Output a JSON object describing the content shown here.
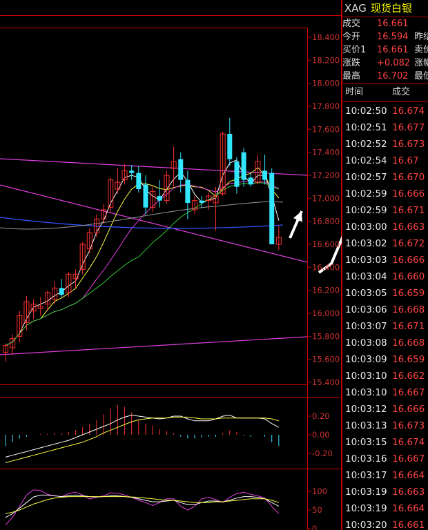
{
  "chart_data": {
    "type": "candlestick",
    "price_axis": {
      "ylim": [
        15.4,
        18.5
      ],
      "ticks": [
        "18.400",
        "18.200",
        "18.000",
        "17.800",
        "17.600",
        "17.400",
        "17.200",
        "17.000",
        "16.800",
        "16.600",
        "16.400",
        "16.200",
        "16.000",
        "15.800",
        "15.600",
        "15.400"
      ],
      "tick_values": [
        18.4,
        18.2,
        18.0,
        17.8,
        17.6,
        17.4,
        17.2,
        17.0,
        16.8,
        16.6,
        16.4,
        16.2,
        16.0,
        15.8,
        15.6,
        15.4
      ]
    },
    "candles": [
      {
        "o": 15.66,
        "h": 15.74,
        "l": 15.58,
        "c": 15.72
      },
      {
        "o": 15.7,
        "h": 15.82,
        "l": 15.64,
        "c": 15.78
      },
      {
        "o": 15.8,
        "h": 16.02,
        "l": 15.75,
        "c": 15.98
      },
      {
        "o": 15.92,
        "h": 16.15,
        "l": 15.85,
        "c": 16.1
      },
      {
        "o": 16.02,
        "h": 16.12,
        "l": 15.95,
        "c": 16.08
      },
      {
        "o": 16.04,
        "h": 16.14,
        "l": 15.98,
        "c": 16.06
      },
      {
        "o": 16.08,
        "h": 16.2,
        "l": 16.02,
        "c": 16.18
      },
      {
        "o": 16.12,
        "h": 16.28,
        "l": 16.08,
        "c": 16.22
      },
      {
        "o": 16.22,
        "h": 16.3,
        "l": 16.14,
        "c": 16.16
      },
      {
        "o": 16.18,
        "h": 16.36,
        "l": 16.14,
        "c": 16.34
      },
      {
        "o": 16.3,
        "h": 16.38,
        "l": 16.22,
        "c": 16.34
      },
      {
        "o": 16.38,
        "h": 16.62,
        "l": 16.34,
        "c": 16.6
      },
      {
        "o": 16.56,
        "h": 16.74,
        "l": 16.52,
        "c": 16.7
      },
      {
        "o": 16.7,
        "h": 16.86,
        "l": 16.66,
        "c": 16.82
      },
      {
        "o": 16.82,
        "h": 16.95,
        "l": 16.78,
        "c": 16.9
      },
      {
        "o": 16.92,
        "h": 17.18,
        "l": 16.88,
        "c": 17.16
      },
      {
        "o": 17.08,
        "h": 17.26,
        "l": 17.04,
        "c": 17.14
      },
      {
        "o": 17.16,
        "h": 17.3,
        "l": 17.12,
        "c": 17.24
      },
      {
        "o": 17.24,
        "h": 17.29,
        "l": 17.16,
        "c": 17.22
      },
      {
        "o": 17.22,
        "h": 17.28,
        "l": 17.05,
        "c": 17.08
      },
      {
        "o": 17.12,
        "h": 17.2,
        "l": 16.86,
        "c": 16.92
      },
      {
        "o": 16.92,
        "h": 17.1,
        "l": 16.88,
        "c": 17.06
      },
      {
        "o": 17.02,
        "h": 17.16,
        "l": 16.92,
        "c": 16.98
      },
      {
        "o": 16.98,
        "h": 17.24,
        "l": 16.95,
        "c": 17.2
      },
      {
        "o": 17.26,
        "h": 17.45,
        "l": 17.1,
        "c": 17.32
      },
      {
        "o": 17.34,
        "h": 17.4,
        "l": 17.05,
        "c": 17.16
      },
      {
        "o": 17.16,
        "h": 17.24,
        "l": 16.82,
        "c": 16.96
      },
      {
        "o": 16.9,
        "h": 17.02,
        "l": 16.86,
        "c": 16.98
      },
      {
        "o": 16.98,
        "h": 17.02,
        "l": 16.92,
        "c": 16.96
      },
      {
        "o": 16.98,
        "h": 17.05,
        "l": 16.9,
        "c": 17.02
      },
      {
        "o": 16.96,
        "h": 17.1,
        "l": 16.72,
        "c": 17.02
      },
      {
        "o": 17.04,
        "h": 17.58,
        "l": 17.02,
        "c": 17.56
      },
      {
        "o": 17.56,
        "h": 17.7,
        "l": 17.28,
        "c": 17.34
      },
      {
        "o": 17.32,
        "h": 17.36,
        "l": 17.04,
        "c": 17.1
      },
      {
        "o": 17.4,
        "h": 17.44,
        "l": 17.1,
        "c": 17.16
      },
      {
        "o": 17.18,
        "h": 17.22,
        "l": 17.1,
        "c": 17.12
      },
      {
        "o": 17.14,
        "h": 17.38,
        "l": 17.12,
        "c": 17.32
      },
      {
        "o": 17.24,
        "h": 17.38,
        "l": 17.12,
        "c": 17.16
      },
      {
        "o": 17.22,
        "h": 17.26,
        "l": 16.62,
        "c": 16.6
      },
      {
        "o": 16.6,
        "h": 16.76,
        "l": 16.55,
        "c": 16.66
      }
    ],
    "macd_axis": {
      "ticks": [
        "0.20",
        "0.00",
        "-0.20"
      ],
      "tick_values": [
        0.2,
        0.0,
        -0.2
      ]
    },
    "kdj_axis": {
      "ticks": [
        "100",
        "50",
        "0"
      ],
      "tick_values": [
        100,
        50,
        0
      ]
    }
  },
  "quote": {
    "symbol": "XAG",
    "name": "现货白银",
    "rows": [
      {
        "label": "成交",
        "value": "16.661",
        "extra": ""
      },
      {
        "label": "今开",
        "value": "16.594",
        "extra": "昨结"
      },
      {
        "label": "买价1",
        "value": "16.661",
        "extra": "卖价"
      },
      {
        "label": "涨跌",
        "value": "+0.082",
        "extra": "涨幅"
      },
      {
        "label": "最高",
        "value": "16.702",
        "extra": "最低"
      }
    ]
  },
  "ticks_table": {
    "header_time": "时间",
    "header_price": "成交",
    "rows": [
      {
        "time": "10:02:50",
        "price": "16.674"
      },
      {
        "time": "10:02:51",
        "price": "16.677"
      },
      {
        "time": "10:02:52",
        "price": "16.673"
      },
      {
        "time": "10:02:54",
        "price": "16.67"
      },
      {
        "time": "10:02:57",
        "price": "16.670"
      },
      {
        "time": "10:02:59",
        "price": "16.666"
      },
      {
        "time": "10:02:59",
        "price": "16.671"
      },
      {
        "time": "10:03:00",
        "price": "16.663"
      },
      {
        "time": "10:03:02",
        "price": "16.672"
      },
      {
        "time": "10:03:03",
        "price": "16.666"
      },
      {
        "time": "10:03:04",
        "price": "16.660"
      },
      {
        "time": "10:03:05",
        "price": "16.659"
      },
      {
        "time": "10:03:06",
        "price": "16.668"
      },
      {
        "time": "10:03:07",
        "price": "16.671"
      },
      {
        "time": "10:03:08",
        "price": "16.668"
      },
      {
        "time": "10:03:09",
        "price": "16.659"
      },
      {
        "time": "10:03:10",
        "price": "16.662"
      },
      {
        "time": "10:03:10",
        "price": "16.667"
      },
      {
        "time": "10:03:12",
        "price": "16.666"
      },
      {
        "time": "10:03:13",
        "price": "16.673"
      },
      {
        "time": "10:03:15",
        "price": "16.674"
      },
      {
        "time": "10:03:16",
        "price": "16.667"
      },
      {
        "time": "10:03:17",
        "price": "16.664"
      },
      {
        "time": "10:03:19",
        "price": "16.663"
      },
      {
        "time": "10:03:19",
        "price": "16.664"
      },
      {
        "time": "10:03:20",
        "price": "16.661"
      }
    ]
  },
  "colors": {
    "up": "#ff3030",
    "down": "#33e6ff",
    "axis": "#cc0000",
    "label": "#cc3333"
  }
}
